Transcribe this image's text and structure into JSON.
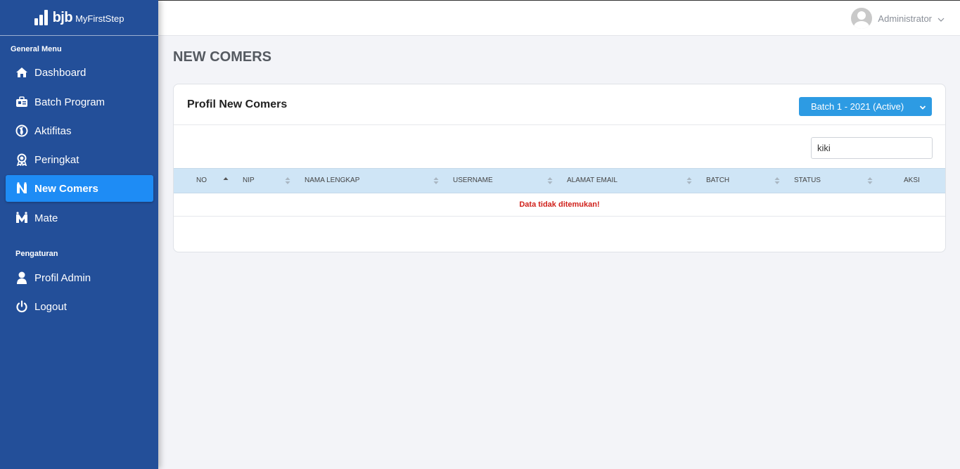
{
  "brand": {
    "short": "bjb",
    "name": "MyFirstStep"
  },
  "sidebar": {
    "general_title": "General Menu",
    "items": [
      {
        "label": "Dashboard",
        "icon": "home-icon"
      },
      {
        "label": "Batch Program",
        "icon": "batch-icon"
      },
      {
        "label": "Aktifitas",
        "icon": "globe-icon"
      },
      {
        "label": "Peringkat",
        "icon": "award-icon"
      },
      {
        "label": "New Comers",
        "icon": "newcomers-icon",
        "active": true
      },
      {
        "label": "Mate",
        "icon": "mate-icon"
      }
    ],
    "settings_title": "Pengaturan",
    "settings_items": [
      {
        "label": "Profil Admin",
        "icon": "user-icon"
      },
      {
        "label": "Logout",
        "icon": "power-icon"
      }
    ]
  },
  "topbar": {
    "user_name": "Administrator"
  },
  "page": {
    "title": "NEW COMERS"
  },
  "card": {
    "title": "Profil New Comers",
    "batch_select": "Batch 1 - 2021 (Active)",
    "search_value": "kiki",
    "columns": [
      "NO",
      "NIP",
      "NAMA LENGKAP",
      "USERNAME",
      "ALAMAT EMAIL",
      "BATCH",
      "STATUS",
      "AKSI"
    ],
    "empty_message": "Data tidak ditemukan!"
  },
  "colors": {
    "sidebar": "#234f99",
    "active_item": "#1e8cf5",
    "batch_button": "#2d9be3",
    "table_header": "#cfe5f6",
    "error_text": "#d0211b"
  }
}
